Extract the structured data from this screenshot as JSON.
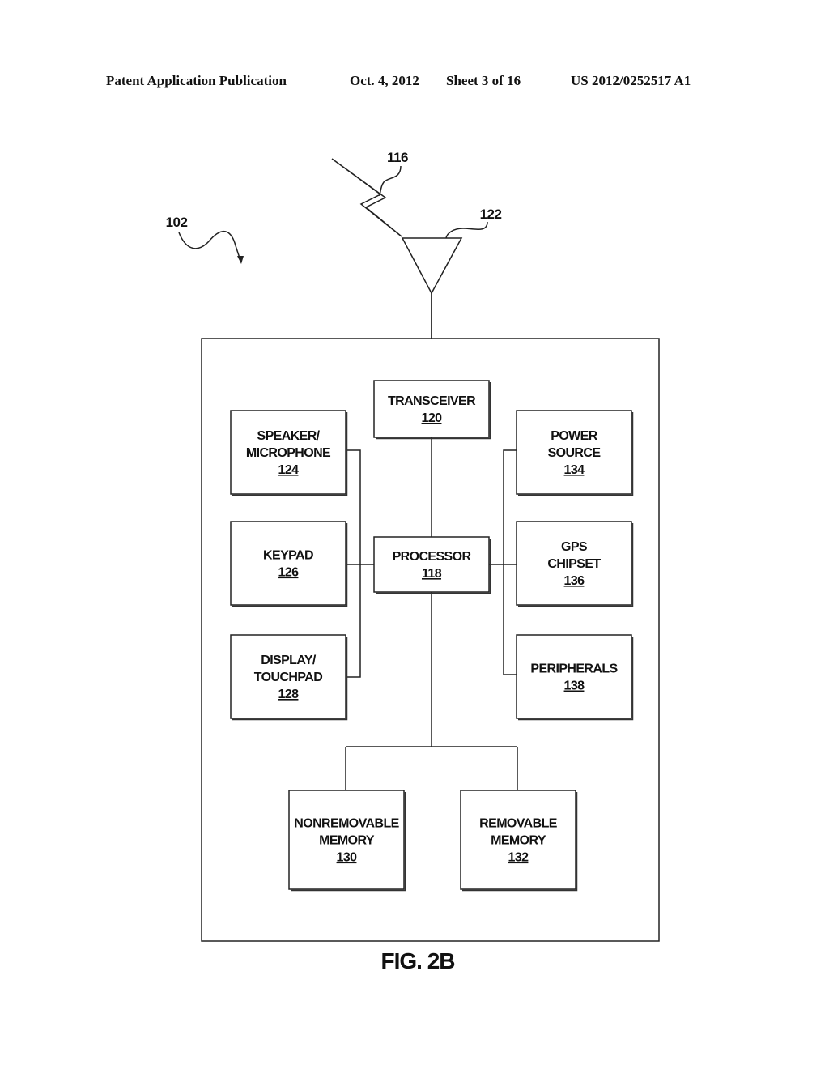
{
  "header": {
    "publication_type": "Patent Application Publication",
    "date": "Oct. 4, 2012",
    "sheet": "Sheet 3 of 16",
    "patent_number": "US 2012/0252517 A1"
  },
  "figure": {
    "caption": "FIG. 2B",
    "device_ref": "102",
    "signal_ref": "116",
    "antenna_ref": "122",
    "blocks": {
      "transceiver": {
        "lines": [
          "TRANSCEIVER"
        ],
        "ref": "120"
      },
      "processor": {
        "lines": [
          "PROCESSOR"
        ],
        "ref": "118"
      },
      "speaker": {
        "lines": [
          "SPEAKER/",
          "MICROPHONE"
        ],
        "ref": "124"
      },
      "keypad": {
        "lines": [
          "KEYPAD"
        ],
        "ref": "126"
      },
      "display": {
        "lines": [
          "DISPLAY/",
          "TOUCHPAD"
        ],
        "ref": "128"
      },
      "power": {
        "lines": [
          "POWER",
          "SOURCE"
        ],
        "ref": "134"
      },
      "gps": {
        "lines": [
          "GPS",
          "CHIPSET"
        ],
        "ref": "136"
      },
      "peripherals": {
        "lines": [
          "PERIPHERALS"
        ],
        "ref": "138"
      },
      "nonremovable": {
        "lines": [
          "NONREMOVABLE",
          "MEMORY"
        ],
        "ref": "130"
      },
      "removable": {
        "lines": [
          "REMOVABLE",
          "MEMORY"
        ],
        "ref": "132"
      }
    }
  }
}
